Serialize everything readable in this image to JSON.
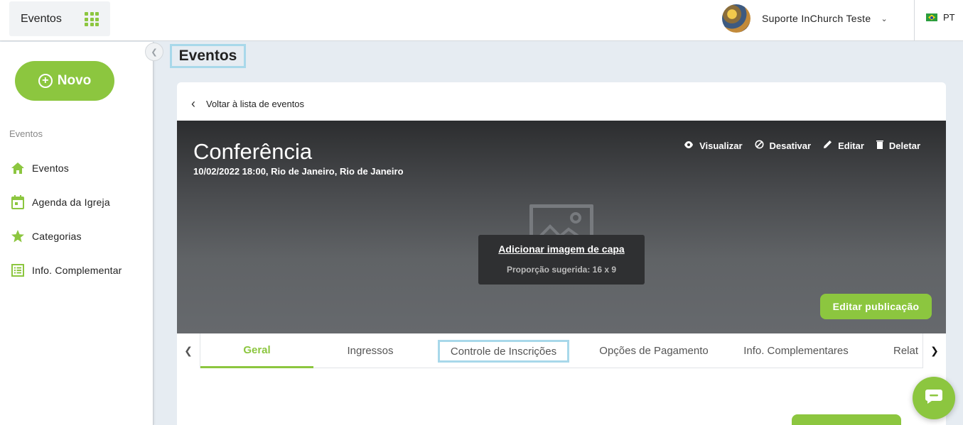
{
  "topbar": {
    "app_label": "Eventos",
    "user_name": "Suporte InChurch Teste",
    "language": "PT"
  },
  "sidebar": {
    "new_button": "Novo",
    "section_label": "Eventos",
    "items": [
      {
        "label": "Eventos",
        "icon": "home-icon"
      },
      {
        "label": "Agenda da Igreja",
        "icon": "calendar-icon"
      },
      {
        "label": "Categorias",
        "icon": "star-icon"
      },
      {
        "label": "Info. Complementar",
        "icon": "list-icon"
      }
    ]
  },
  "main": {
    "page_title": "Eventos",
    "back_label": "Voltar à lista de eventos",
    "event": {
      "title": "Conferência",
      "meta": "10/02/2022 18:00, Rio de Janeiro, Rio de Janeiro"
    },
    "actions": [
      {
        "label": "Visualizar",
        "icon": "eye-icon"
      },
      {
        "label": "Desativar",
        "icon": "block-icon"
      },
      {
        "label": "Editar",
        "icon": "pencil-icon"
      },
      {
        "label": "Deletar",
        "icon": "trash-icon"
      }
    ],
    "cover": {
      "add_label": "Adicionar imagem de capa",
      "ratio_label": "Proporção sugerida: 16 x 9"
    },
    "edit_publication": "Editar publicação",
    "tabs": [
      {
        "label": "Geral",
        "active": true
      },
      {
        "label": "Ingressos"
      },
      {
        "label": "Controle de Inscrições"
      },
      {
        "label": "Opções de Pagamento"
      },
      {
        "label": "Info. Complementares"
      },
      {
        "label": "Relat"
      }
    ]
  },
  "colors": {
    "accent": "#8cc63f",
    "highlight": "#a8d8ea"
  }
}
